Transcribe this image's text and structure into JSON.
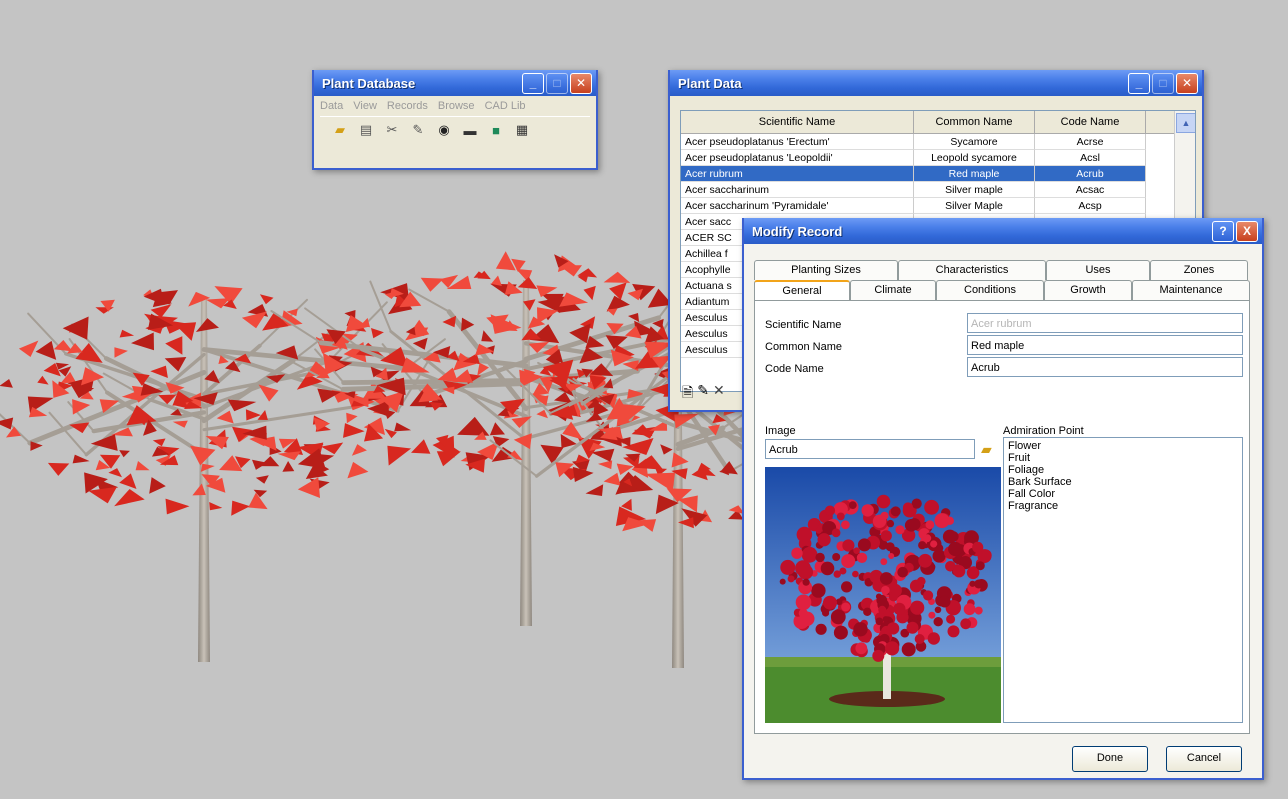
{
  "plant_database": {
    "title": "Plant Database",
    "menu": [
      "Data",
      "View",
      "Records",
      "Browse",
      "CAD Lib"
    ],
    "toolbar_icons": [
      "open-folder-icon",
      "print-icon",
      "scissors-icon",
      "edit-icon",
      "binoculars-icon",
      "stamp-icon",
      "green-square-icon",
      "grid-icon"
    ]
  },
  "plant_data": {
    "title": "Plant Data",
    "columns": [
      "Scientific Name",
      "Common Name",
      "Code Name"
    ],
    "rows": [
      {
        "sci": "Acer pseudoplatanus 'Erectum'",
        "common": "Sycamore",
        "code": "Acrse"
      },
      {
        "sci": "Acer pseudoplatanus 'Leopoldii'",
        "common": "Leopold sycamore",
        "code": "Acsl"
      },
      {
        "sci": "Acer rubrum",
        "common": "Red maple",
        "code": "Acrub"
      },
      {
        "sci": "Acer saccharinum",
        "common": "Silver maple",
        "code": "Acsac"
      },
      {
        "sci": "Acer saccharinum 'Pyramidale'",
        "common": "Silver Maple",
        "code": "Acsp"
      },
      {
        "sci": "Acer sacc",
        "common": "",
        "code": ""
      },
      {
        "sci": "ACER SC",
        "common": "",
        "code": ""
      },
      {
        "sci": "Achillea f",
        "common": "",
        "code": ""
      },
      {
        "sci": "Acophylle",
        "common": "",
        "code": ""
      },
      {
        "sci": "Actuana s",
        "common": "",
        "code": ""
      },
      {
        "sci": "Adiantum",
        "common": "",
        "code": ""
      },
      {
        "sci": "Aesculus",
        "common": "",
        "code": ""
      },
      {
        "sci": "Aesculus",
        "common": "",
        "code": ""
      },
      {
        "sci": "Aesculus",
        "common": "",
        "code": ""
      }
    ],
    "selected_index": 2
  },
  "modify_record": {
    "title": "Modify Record",
    "tabs_top": [
      "Planting Sizes",
      "Characteristics",
      "Uses",
      "Zones"
    ],
    "tabs_bottom": [
      "General",
      "Climate",
      "Conditions",
      "Growth",
      "Maintenance"
    ],
    "active_tab": "General",
    "scientific_name_label": "Scientific Name",
    "scientific_name_value": "Acer rubrum",
    "common_name_label": "Common Name",
    "common_name_value": "Red maple",
    "code_name_label": "Code Name",
    "code_name_value": "Acrub",
    "image_label": "Image",
    "image_value": "Acrub",
    "admiration_label": "Admiration Point",
    "admiration_points": [
      "Flower",
      "Fruit",
      "Foliage",
      "Bark Surface",
      "Fall Color",
      "Fragrance"
    ],
    "done_label": "Done",
    "cancel_label": "Cancel",
    "help_glyph": "?",
    "close_glyph": "X"
  },
  "colors": {
    "background": "#c4c4c4",
    "leaf_red": "#e0342c",
    "branch": "#a59e95",
    "selection": "#316ac5",
    "title_blue": "#3168d8"
  }
}
